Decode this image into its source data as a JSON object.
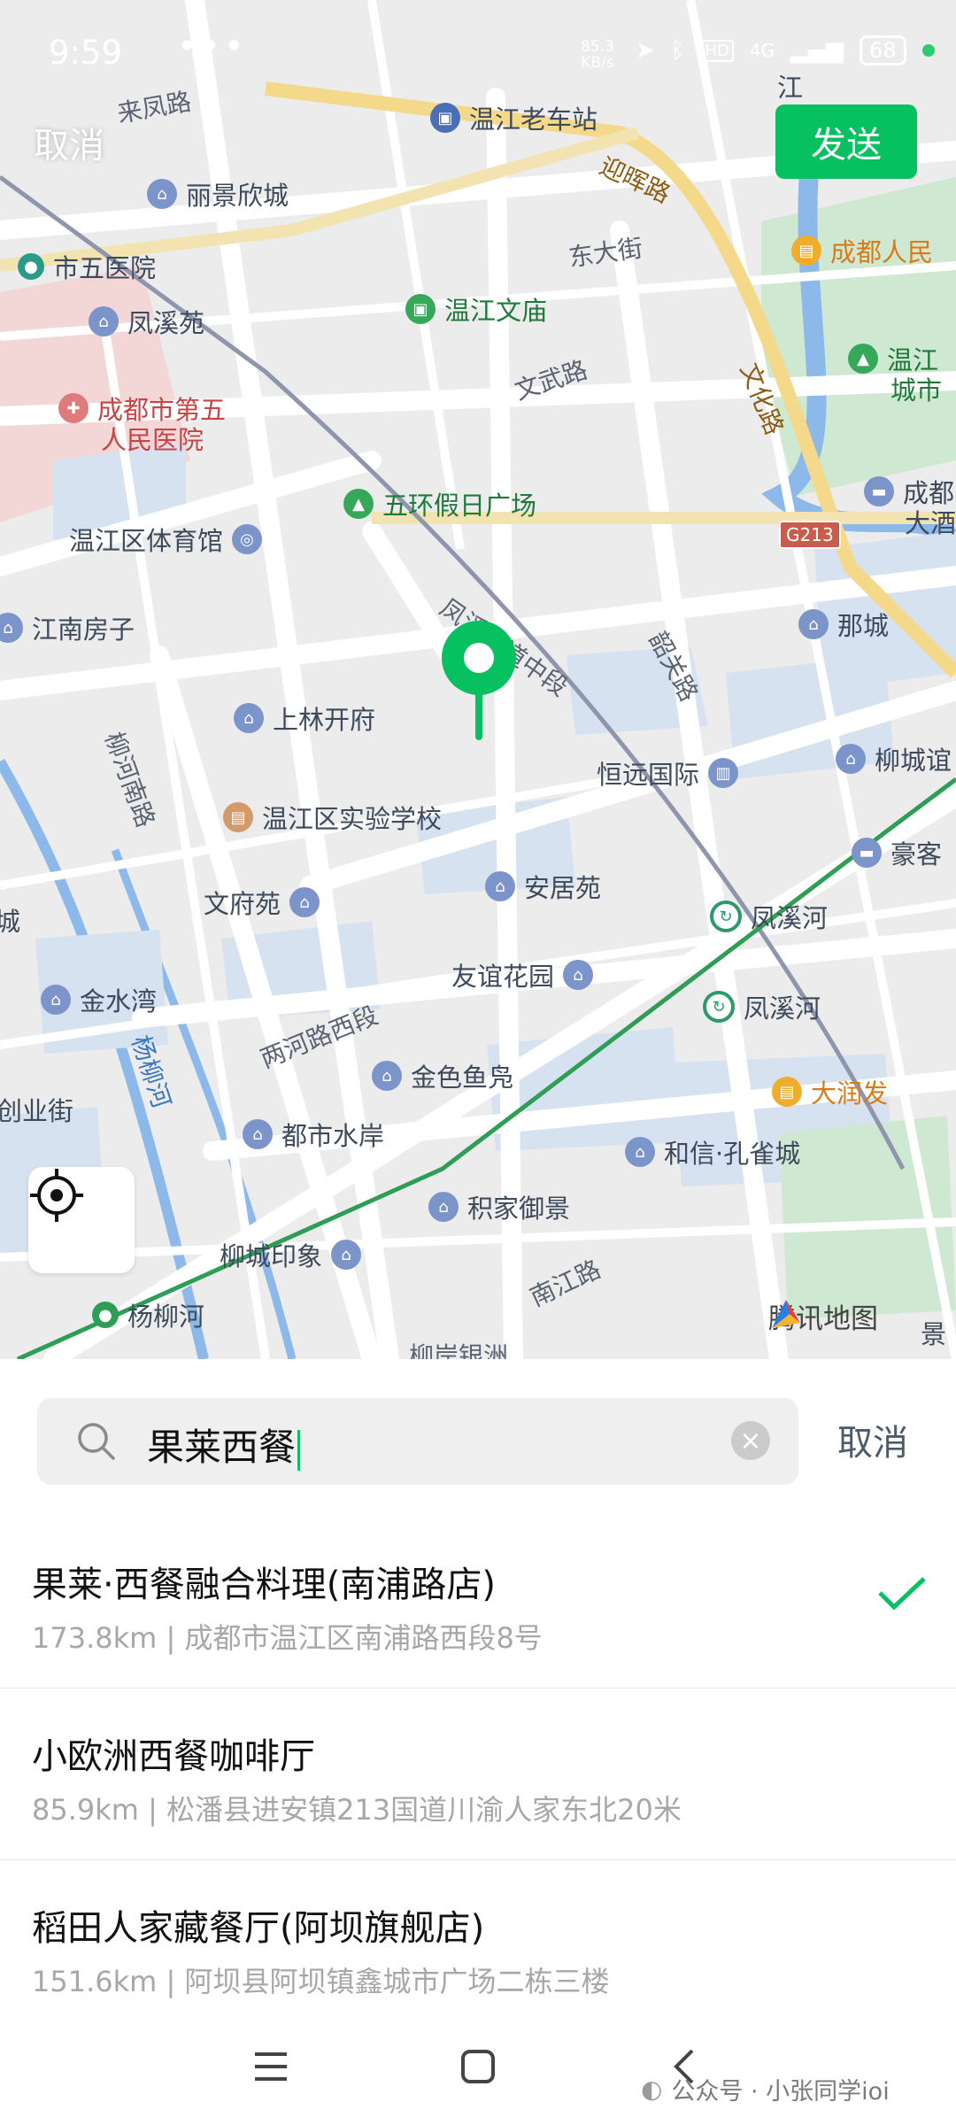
{
  "status_bar": {
    "time": "9:59",
    "dots": "•••",
    "speed_value": "85.3",
    "speed_unit": "KB/s",
    "network": "4G",
    "hd": "HD",
    "battery": "68"
  },
  "top": {
    "cancel_label": "取消",
    "send_label": "发送"
  },
  "colors": {
    "brand_green": "#07c160",
    "map_bg": "#ececec",
    "water": "#cfe0f4",
    "park": "#cfe8d2"
  },
  "map": {
    "roads": [
      "来凤路",
      "迎晖路",
      "东大街",
      "文武路",
      "文化路",
      "凤溪大道中段",
      "韶关路",
      "柳河南路",
      "两河路西段",
      "杨柳河",
      "南江路",
      "G213",
      "柳岸银洲"
    ],
    "pois": [
      {
        "label": "温江老车站",
        "kind": "metro"
      },
      {
        "label": "丽景欣城",
        "kind": "res"
      },
      {
        "label": "市五医院",
        "kind": "metro"
      },
      {
        "label": "凤溪苑",
        "kind": "res"
      },
      {
        "label": "温江文庙",
        "kind": "park"
      },
      {
        "label": "成都人民",
        "kind": "mall"
      },
      {
        "label": "成都市第五",
        "kind": "hosp"
      },
      {
        "label": "人民医院",
        "kind": "hosp"
      },
      {
        "label": "温江",
        "kind": "park"
      },
      {
        "label": "城市",
        "kind": "park"
      },
      {
        "label": "五环假日广场",
        "kind": "park"
      },
      {
        "label": "成都",
        "kind": "res"
      },
      {
        "label": "大酒",
        "kind": "res"
      },
      {
        "label": "温江区体育馆",
        "kind": "res"
      },
      {
        "label": "江南房子",
        "kind": "res"
      },
      {
        "label": "那城",
        "kind": "res"
      },
      {
        "label": "上林开府",
        "kind": "res"
      },
      {
        "label": "柳城谊",
        "kind": "res"
      },
      {
        "label": "恒远国际",
        "kind": "res"
      },
      {
        "label": "温江区实验学校",
        "kind": "school"
      },
      {
        "label": "豪客",
        "kind": "res"
      },
      {
        "label": "安居苑",
        "kind": "res"
      },
      {
        "label": "文府苑",
        "kind": "res"
      },
      {
        "label": "凤溪河",
        "kind": "metro"
      },
      {
        "label": "金水湾",
        "kind": "res"
      },
      {
        "label": "友谊花园",
        "kind": "res"
      },
      {
        "label": "凤溪河",
        "kind": "metro"
      },
      {
        "label": "金色鱼凫",
        "kind": "res"
      },
      {
        "label": "大润发",
        "kind": "mall"
      },
      {
        "label": "创业街",
        "kind": "res"
      },
      {
        "label": "都市水岸",
        "kind": "res"
      },
      {
        "label": "和信·孔雀城",
        "kind": "res"
      },
      {
        "label": "积家御景",
        "kind": "res"
      },
      {
        "label": "柳城印象",
        "kind": "res"
      },
      {
        "label": "杨柳河",
        "kind": "metro"
      },
      {
        "label": "景",
        "kind": "res"
      },
      {
        "label": "城",
        "kind": "res"
      },
      {
        "label": "江",
        "kind": "res"
      }
    ],
    "map_provider": "腾讯地图"
  },
  "search": {
    "query": "果莱西餐",
    "cancel_label": "取消"
  },
  "results": [
    {
      "name": "果莱·西餐融合料理(南浦路店)",
      "address": "173.8km | 成都市温江区南浦路西段8号",
      "selected": true
    },
    {
      "name": "小欧洲西餐咖啡厅",
      "address": "85.9km | 松潘县进安镇213国道川渝人家东北20米",
      "selected": false
    },
    {
      "name": "稻田人家藏餐厅(阿坝旗舰店)",
      "address": "151.6km | 阿坝县阿坝镇鑫城市广场二栋三楼",
      "selected": false
    }
  ],
  "watermark": "公众号 · 小张同学ioi"
}
